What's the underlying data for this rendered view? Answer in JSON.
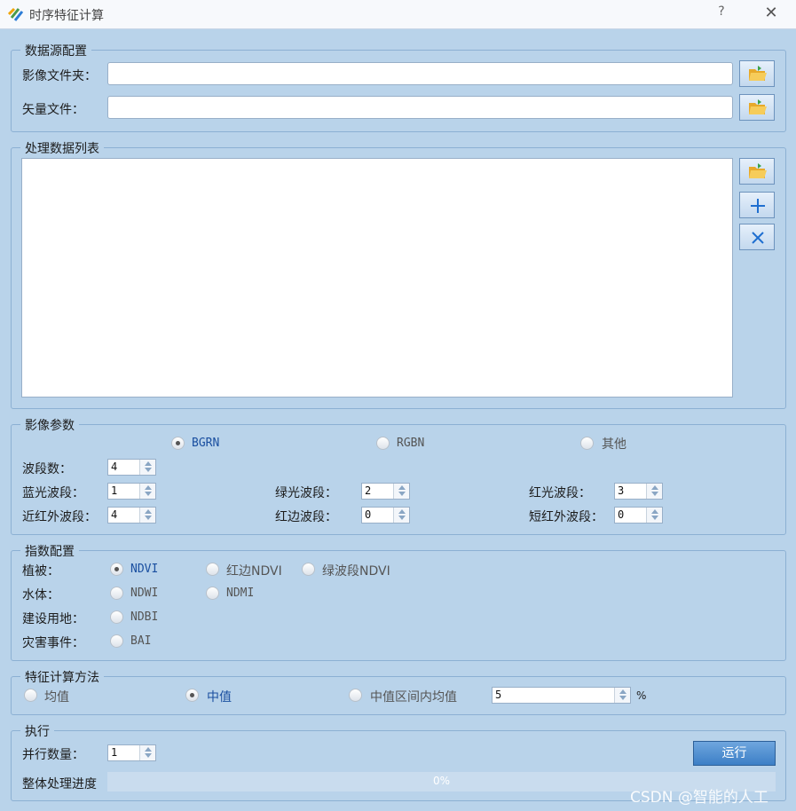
{
  "window": {
    "title": "时序特征计算",
    "help": "?",
    "close": "✕"
  },
  "data_source": {
    "legend": "数据源配置",
    "image_folder_label": "影像文件夹：",
    "image_folder_value": "",
    "vector_file_label": "矢量文件：",
    "vector_file_value": ""
  },
  "process_list": {
    "legend": "处理数据列表",
    "items": []
  },
  "image_params": {
    "legend": "影像参数",
    "order_options": [
      {
        "label": "BGRN",
        "checked": true
      },
      {
        "label": "RGBN",
        "checked": false
      },
      {
        "label": "其他",
        "checked": false
      }
    ],
    "band_count_label": "波段数：",
    "band_count": "4",
    "blue_label": "蓝光波段：",
    "blue": "1",
    "green_label": "绿光波段：",
    "green": "2",
    "red_label": "红光波段：",
    "red": "3",
    "nir_label": "近红外波段：",
    "nir": "4",
    "rededge_label": "红边波段：",
    "rededge": "0",
    "swir_label": "短红外波段：",
    "swir": "0"
  },
  "index_config": {
    "legend": "指数配置",
    "vegetation_label": "植被：",
    "vegetation_options": [
      {
        "label": "NDVI",
        "checked": true
      },
      {
        "label": "红边NDVI",
        "checked": false
      },
      {
        "label": "绿波段NDVI",
        "checked": false
      }
    ],
    "water_label": "水体：",
    "water_options": [
      {
        "label": "NDWI",
        "checked": false
      },
      {
        "label": "NDMI",
        "checked": false
      }
    ],
    "builtup_label": "建设用地：",
    "builtup_options": [
      {
        "label": "NDBI",
        "checked": false
      }
    ],
    "disaster_label": "灾害事件：",
    "disaster_options": [
      {
        "label": "BAI",
        "checked": false
      }
    ]
  },
  "feature_method": {
    "legend": "特征计算方法",
    "options": [
      {
        "label": "均值",
        "checked": false
      },
      {
        "label": "中值",
        "checked": true
      },
      {
        "label": "中值区间内均值",
        "checked": false
      }
    ],
    "interval_value": "5",
    "interval_unit": "%"
  },
  "execute": {
    "legend": "执行",
    "parallel_label": "并行数量：",
    "parallel_value": "1",
    "run_label": "运行",
    "progress_label": "整体处理进度",
    "progress_text": "0%",
    "progress_value": 0
  },
  "watermark": "CSDN @智能的人工"
}
